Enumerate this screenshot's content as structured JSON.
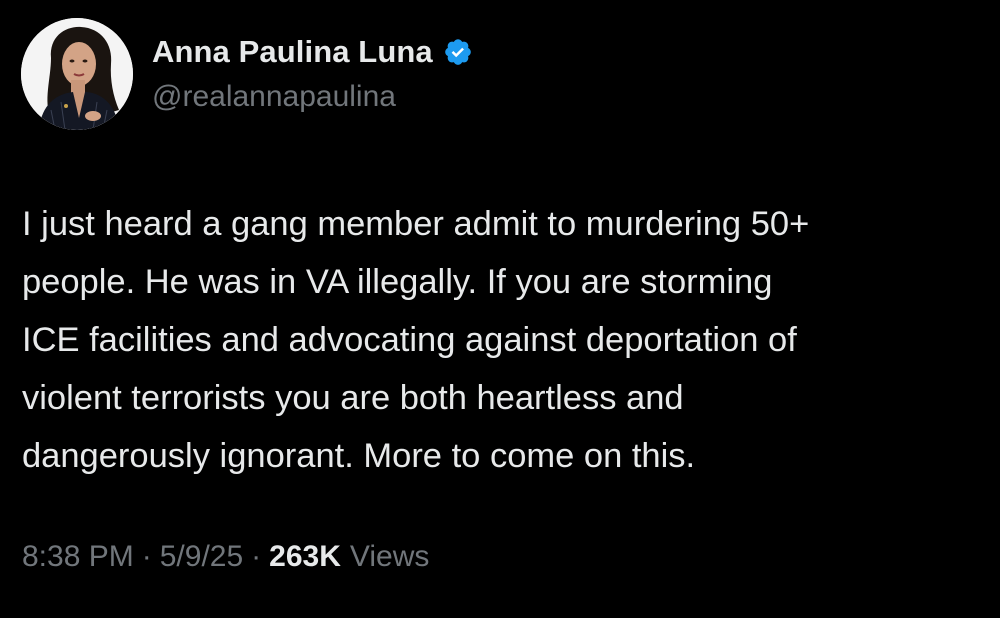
{
  "author": {
    "name": "Anna Paulina Luna",
    "handle": "@realannapaulina",
    "verified": true,
    "verified_icon": "verified-badge-icon",
    "verified_color": "#1d9bf0"
  },
  "tweet": {
    "text": "I just heard a gang member admit to murdering 50+\npeople. He was in VA illegally. If you are storming\nICE facilities and advocating against deportation of\nviolent terrorists you are both heartless and\ndangerously ignorant. More to come on this."
  },
  "meta": {
    "time": "8:38 PM",
    "separator": "·",
    "date": "5/9/25",
    "views_count": "263K",
    "views_label": "Views"
  },
  "colors": {
    "background": "#000000",
    "primary_text": "#e7e9ea",
    "secondary_text": "#71767b"
  }
}
